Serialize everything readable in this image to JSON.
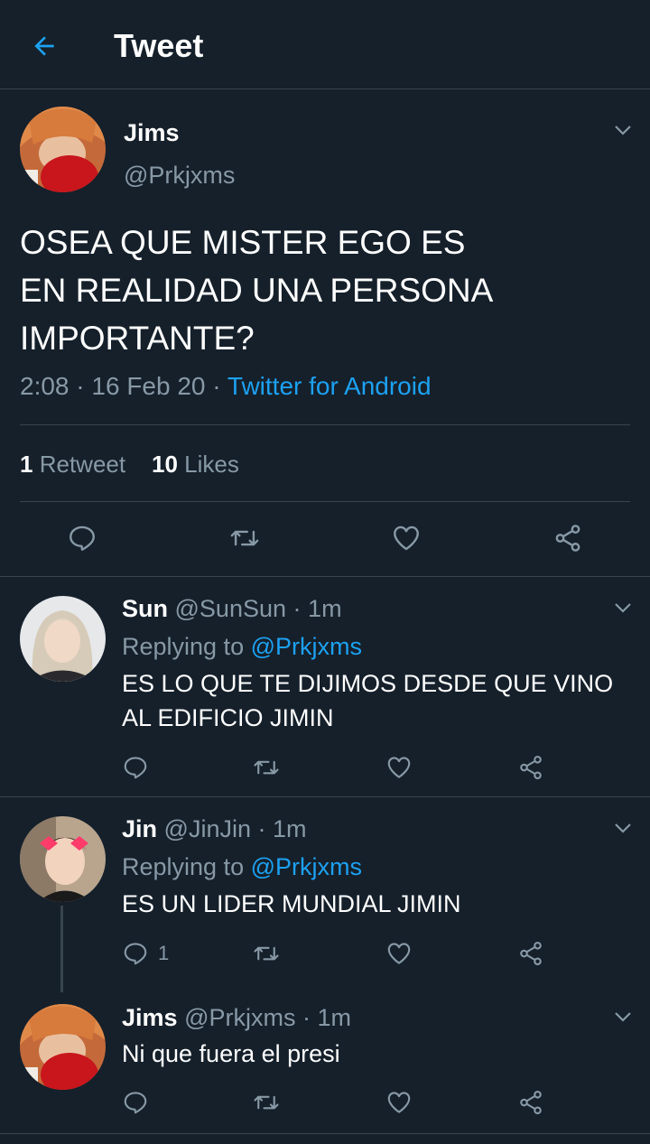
{
  "header": {
    "title": "Tweet"
  },
  "main_tweet": {
    "name": "Jims",
    "handle": "@Prkjxms",
    "text": "OSEA QUE MISTER EGO ES\nEN REALIDAD UNA PERSONA\nIMPORTANTE?",
    "time": "2:08",
    "date": "16 Feb 20",
    "source": "Twitter for Android",
    "retweets_count": "1",
    "retweets_label": "Retweet",
    "likes_count": "10",
    "likes_label": "Likes"
  },
  "replies": [
    {
      "name": "Sun",
      "handle": "@SunSun",
      "age": "1m",
      "replying_prefix": "Replying to",
      "replying_to": "@Prkjxms",
      "text": "ES LO QUE TE DIJIMOS DESDE QUE VINO\nAL EDIFICIO JIMIN",
      "reply_count": ""
    },
    {
      "name": "Jin",
      "handle": "@JinJin",
      "age": "1m",
      "replying_prefix": "Replying to",
      "replying_to": "@Prkjxms",
      "text": "ES UN LIDER MUNDIAL JIMIN",
      "reply_count": "1"
    },
    {
      "name": "Jims",
      "handle": "@Prkjxms",
      "age": "1m",
      "text": "Ni que fuera el presi",
      "reply_count": ""
    }
  ],
  "separator": "·",
  "colors": {
    "background": "#15202b",
    "accent": "#1da1f2",
    "secondary_text": "#8899a6",
    "border": "#38444d"
  },
  "icons": [
    "back-arrow-icon",
    "chevron-down-icon",
    "reply-icon",
    "retweet-icon",
    "like-icon",
    "share-icon"
  ]
}
